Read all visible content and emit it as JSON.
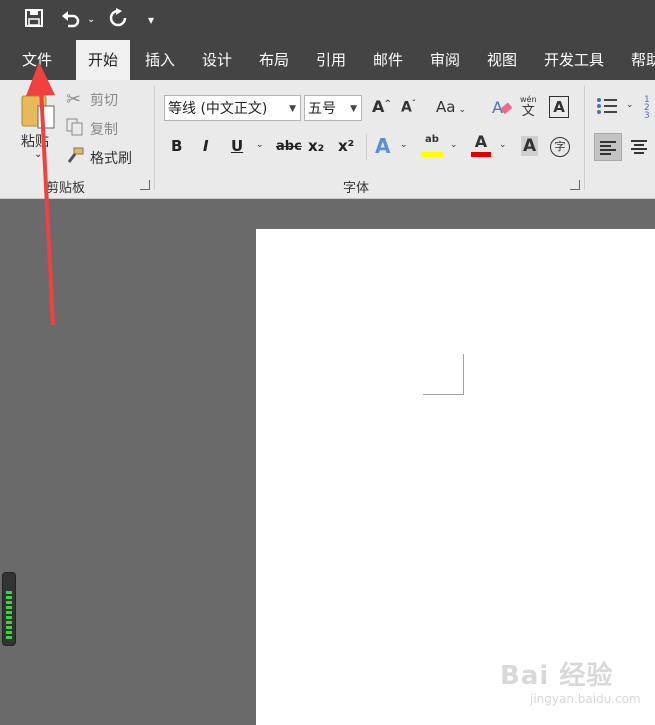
{
  "tabs": [
    {
      "label": "文件"
    },
    {
      "label": "开始"
    },
    {
      "label": "插入"
    },
    {
      "label": "设计"
    },
    {
      "label": "布局"
    },
    {
      "label": "引用"
    },
    {
      "label": "邮件"
    },
    {
      "label": "审阅"
    },
    {
      "label": "视图"
    },
    {
      "label": "开发工具"
    },
    {
      "label": "帮助"
    }
  ],
  "clipboard": {
    "paste": "粘贴",
    "cut": "剪切",
    "copy": "复制",
    "format_painter": "格式刷",
    "group_label": "剪贴板"
  },
  "font": {
    "name": "等线 (中文正文)",
    "size": "五号",
    "case_label": "Aa",
    "pinyin_top": "wén",
    "pinyin_bottom": "文",
    "bold": "B",
    "italic": "I",
    "underline": "U",
    "strike": "abc",
    "subscript": "x₂",
    "superscript": "x²",
    "char_shading": "A",
    "enclose": "字",
    "highlight_label": "ab",
    "group_label": "字体"
  },
  "watermark": {
    "main": "Bai 经验",
    "sub": "jingyan.baidu.com"
  },
  "colors": {
    "highlight": "#ffff00",
    "font_color": "#e00000",
    "accent": "#4472c4",
    "arrow": "#f04040"
  }
}
